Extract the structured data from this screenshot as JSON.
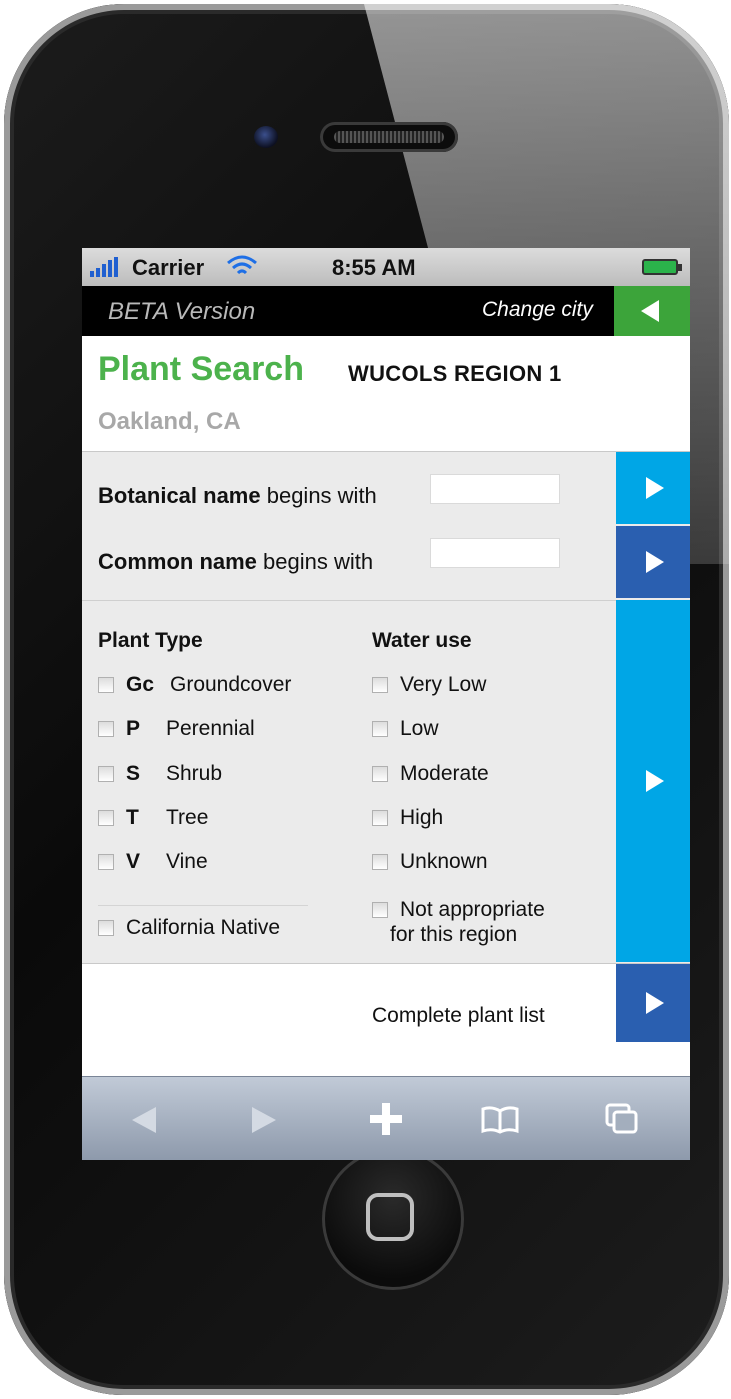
{
  "status_bar": {
    "carrier": "Carrier",
    "time": "8:55 AM",
    "wifi_icon": "wifi-icon",
    "signal_icon": "signal-bars-icon",
    "battery_icon": "battery-icon"
  },
  "top_bar": {
    "beta_label": "BETA Version",
    "change_city_label": "Change city",
    "back_icon": "triangle-left-icon"
  },
  "header": {
    "title": "Plant Search",
    "region": "WUCOLS REGION 1",
    "city": "Oakland, CA"
  },
  "search": {
    "botanical": {
      "bold": "Botanical name",
      "rest": " begins with",
      "value": ""
    },
    "common": {
      "bold": "Common name",
      "rest": " begins with",
      "value": ""
    }
  },
  "plant_type": {
    "heading": "Plant Type",
    "items": [
      {
        "code": "Gc",
        "label": "Groundcover",
        "checked": false
      },
      {
        "code": "P",
        "label": "Perennial",
        "checked": false
      },
      {
        "code": "S",
        "label": "Shrub",
        "checked": false
      },
      {
        "code": "T",
        "label": "Tree",
        "checked": false
      },
      {
        "code": "V",
        "label": "Vine",
        "checked": false
      }
    ],
    "native": {
      "label": "California Native",
      "checked": false
    }
  },
  "water_use": {
    "heading": "Water use",
    "items": [
      {
        "label": "Very Low",
        "checked": false
      },
      {
        "label": "Low",
        "checked": false
      },
      {
        "label": "Moderate",
        "checked": false
      },
      {
        "label": "High",
        "checked": false
      },
      {
        "label": "Unknown",
        "checked": false
      },
      {
        "label": "Not appropriate",
        "label2": "for this region",
        "checked": false
      }
    ]
  },
  "complete_list": {
    "label": "Complete plant list"
  },
  "toolbar": {
    "back_icon": "back-arrow-icon",
    "forward_icon": "forward-arrow-icon",
    "add_icon": "plus-icon",
    "bookmarks_icon": "book-icon",
    "pages_icon": "pages-icon"
  },
  "colors": {
    "green_title": "#4cb24c",
    "green_button": "#3ca43a",
    "cyan_button": "#00a6e6",
    "blue_button": "#2a5fb0"
  }
}
